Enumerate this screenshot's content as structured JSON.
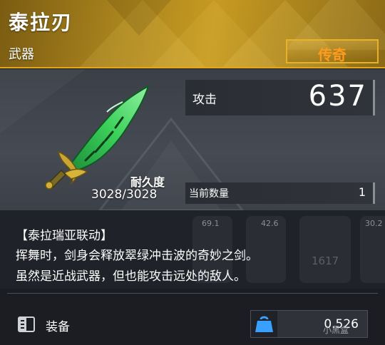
{
  "item": {
    "name": "泰拉刃",
    "type": "武器",
    "rarity": "传奇"
  },
  "stats": {
    "attack_label": "攻击",
    "attack_value": "637",
    "durability_label": "耐久度",
    "durability_value": "3028/3028",
    "count_label": "当前数量",
    "count_value": "1"
  },
  "description": {
    "title": "【泰拉瑞亚联动】",
    "line1": "挥舞时，剑身会释放翠绿冲击波的奇妙之剑。",
    "line2": "虽然是近战武器，但也能攻击远处的敌人。"
  },
  "background_numbers": [
    "69.1",
    "42.6",
    "30.2",
    "1617"
  ],
  "footer": {
    "equip_label": "装备",
    "weight_value": "0.526",
    "watermark": "小黑盒"
  },
  "colors": {
    "rarity_text": "#ff9a1c",
    "rarity_border": "#e8b226",
    "weight_icon": "#3aa0ff",
    "weapon_green": "#3bd15a"
  },
  "icons": [
    "terra-blade-weapon-icon",
    "equip-book-icon",
    "weight-bag-icon"
  ]
}
